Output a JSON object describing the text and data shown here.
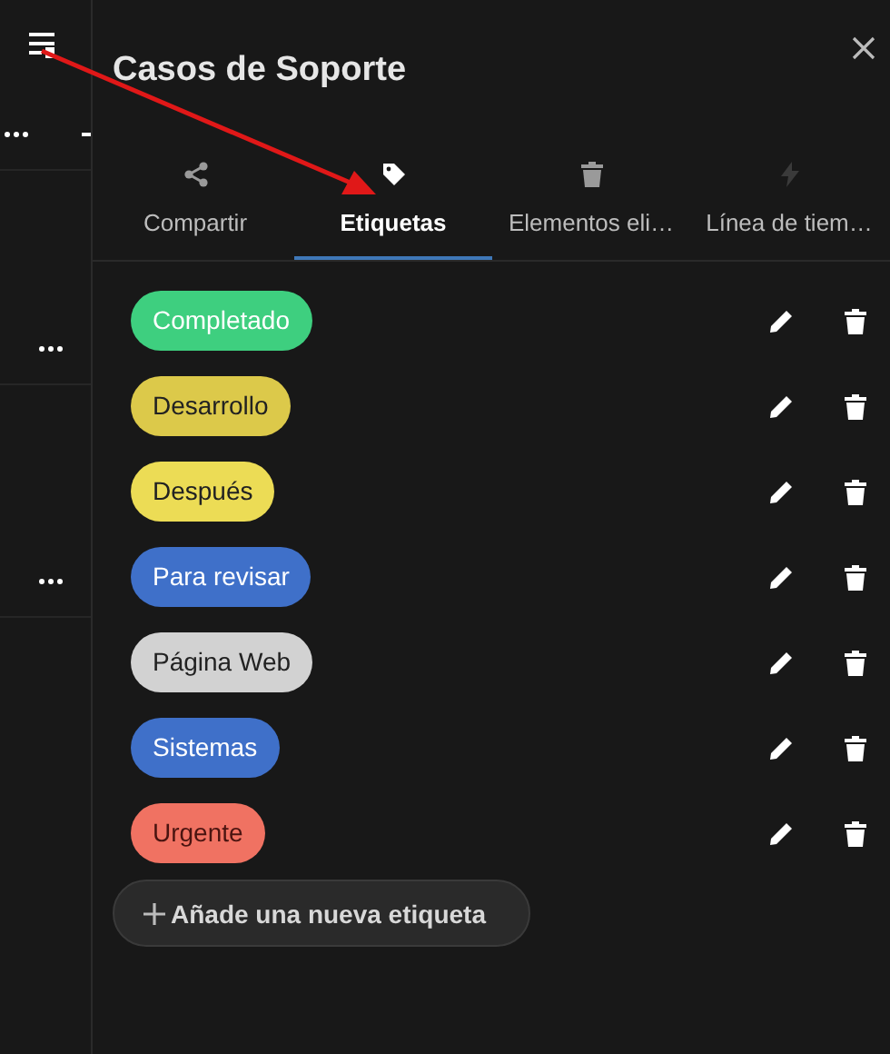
{
  "panel": {
    "title": "Casos de Soporte"
  },
  "tabs": [
    {
      "label": "Compartir",
      "kind": "share",
      "selected": false
    },
    {
      "label": "Etiquetas",
      "kind": "tag",
      "selected": true
    },
    {
      "label": "Elementos eli…",
      "kind": "trash",
      "selected": false
    },
    {
      "label": "Línea de tiem…",
      "kind": "bolt",
      "selected": false
    }
  ],
  "tags": [
    {
      "name": "Completado",
      "color": "#3ecf7f"
    },
    {
      "name": "Desarrollo",
      "color": "#dcc94a"
    },
    {
      "name": "Después",
      "color": "#ecdc55"
    },
    {
      "name": "Para revisar",
      "color": "#3f70c9"
    },
    {
      "name": "Página Web",
      "color": "#d2d2d2"
    },
    {
      "name": "Sistemas",
      "color": "#3f70c9"
    },
    {
      "name": "Urgente",
      "color": "#f07262"
    }
  ],
  "add_button": {
    "label": "Añade una nueva etiqueta"
  }
}
